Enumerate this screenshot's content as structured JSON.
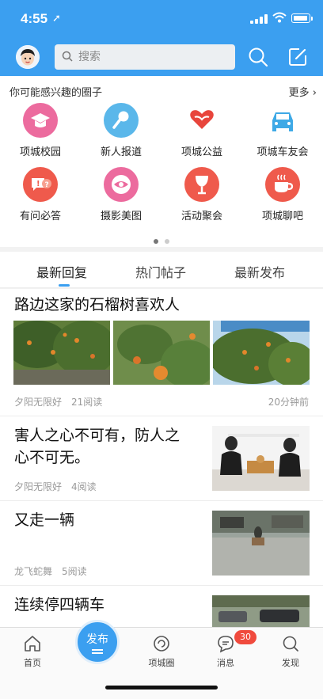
{
  "status": {
    "time": "4:55"
  },
  "header": {
    "search_placeholder": "搜索"
  },
  "circles": {
    "title": "你可能感兴趣的圈子",
    "more": "更多",
    "items": [
      {
        "label": "项城校园",
        "icon": "graduation-cap-icon",
        "color": "#ec6b9e"
      },
      {
        "label": "新人报道",
        "icon": "microphone-icon",
        "color": "#5ab7ea"
      },
      {
        "label": "项城公益",
        "icon": "heart-hands-icon",
        "color": "#e8453c"
      },
      {
        "label": "项城车友会",
        "icon": "car-icon",
        "color": "#3ea9e6"
      },
      {
        "label": "有问必答",
        "icon": "question-chat-icon",
        "color": "#ef5a4c"
      },
      {
        "label": "摄影美图",
        "icon": "camera-eye-icon",
        "color": "#ec6b9e"
      },
      {
        "label": "活动聚会",
        "icon": "wine-glass-icon",
        "color": "#ef5a4c"
      },
      {
        "label": "项城聊吧",
        "icon": "coffee-cup-icon",
        "color": "#ef5a4c"
      }
    ],
    "page_indicator": {
      "current": 1,
      "total": 2
    }
  },
  "tabs": [
    {
      "label": "最新回复",
      "active": true
    },
    {
      "label": "热门帖子",
      "active": false
    },
    {
      "label": "最新发布",
      "active": false
    }
  ],
  "posts": [
    {
      "title": "路边这家的石榴树喜欢人",
      "author": "夕阳无限好",
      "views": "21阅读",
      "time": "20分钟前"
    },
    {
      "title_line1": "害人之心不可有，防人之",
      "title_line2": "心不可无。",
      "author": "夕阳无限好",
      "views": "4阅读"
    },
    {
      "title": "又走一辆",
      "author": "龙飞蛇舞",
      "views": "5阅读"
    },
    {
      "title": "连续停四辆车"
    }
  ],
  "tabbar": {
    "home": "首页",
    "publish": "发布",
    "circle": "项城圈",
    "messages": "消息",
    "messages_badge": "30",
    "discover": "发现"
  },
  "colors": {
    "brand": "#3b9ff0",
    "badge": "#f04a3d"
  }
}
